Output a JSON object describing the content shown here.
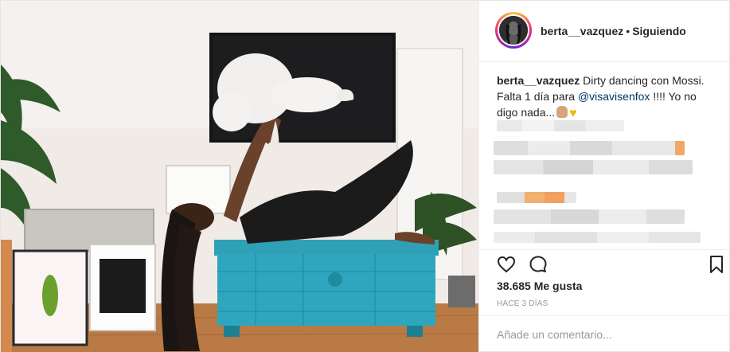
{
  "post": {
    "image_alt": "Photo",
    "author": {
      "username": "berta__vazquez",
      "follow_status": "Siguiendo",
      "separator": "•"
    },
    "caption": {
      "username": "berta__vazquez",
      "text_before": "Dirty dancing con Mossi. Falta 1 día para",
      "mention": "@visavisenfox",
      "text_after": "!!!! Yo no digo nada..."
    },
    "likes": "38.685 Me gusta",
    "timestamp": "HACE 3 DÍAS",
    "comment_placeholder": "Añade un comentario..."
  },
  "icons": {
    "like": "heart-icon",
    "comment": "comment-icon",
    "save": "bookmark-icon",
    "emoji_hand": "raised-hand-emoji",
    "emoji_heart": "yellow-heart-emoji"
  },
  "colors": {
    "mention": "#003569",
    "border": "#efefef",
    "muted": "#999999",
    "text": "#262626"
  }
}
